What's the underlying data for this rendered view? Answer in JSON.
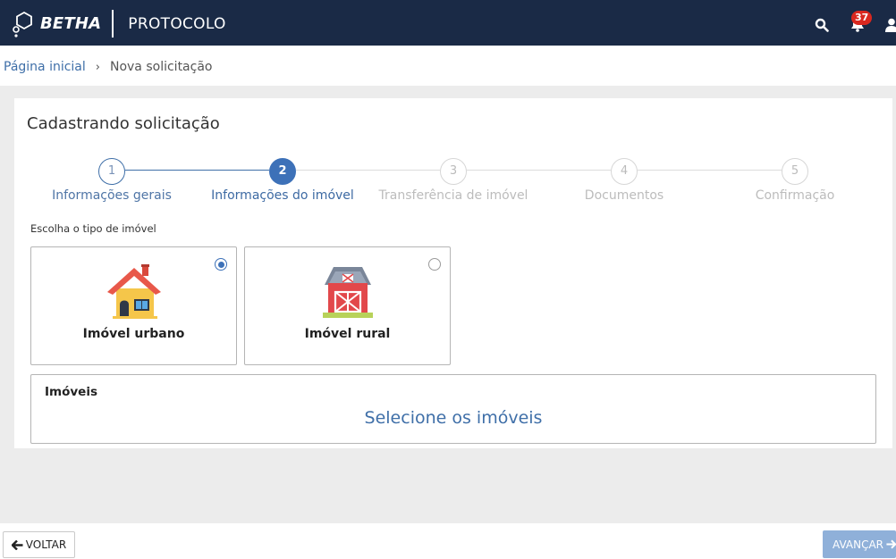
{
  "header": {
    "brand_name": "BETHA",
    "app_name": "PROTOCOLO",
    "notification_count": "37",
    "icons": [
      "betha-logo-icon",
      "search-icon",
      "bell-icon",
      "user-icon"
    ]
  },
  "breadcrumb": {
    "home": "Página inicial",
    "separator": "›",
    "current": "Nova solicitação"
  },
  "card": {
    "title": "Cadastrando solicitação"
  },
  "stepper": {
    "current_step": 2,
    "steps": [
      {
        "number": "1",
        "label": "Informações gerais",
        "state": "done"
      },
      {
        "number": "2",
        "label": "Informações do imóvel",
        "state": "active"
      },
      {
        "number": "3",
        "label": "Transferência de imóvel",
        "state": "pending"
      },
      {
        "number": "4",
        "label": "Documentos",
        "state": "pending"
      },
      {
        "number": "5",
        "label": "Confirmação",
        "state": "pending"
      }
    ]
  },
  "property_type": {
    "label": "Escolha o tipo de imóvel",
    "selected": "urbano",
    "options": [
      {
        "id": "urbano",
        "label": "Imóvel urbano",
        "icon": "house-icon",
        "checked": true
      },
      {
        "id": "rural",
        "label": "Imóvel rural",
        "icon": "barn-icon",
        "checked": false
      }
    ]
  },
  "imoveis": {
    "title": "Imóveis",
    "action": "Selecione os imóveis"
  },
  "footer": {
    "back_label": "VOLTAR",
    "next_label": "AVANÇAR"
  },
  "colors": {
    "topbar": "#1a2a46",
    "accent": "#3d71b8",
    "link": "#3f6fa8",
    "next_button": "#8fb0d9",
    "badge": "#d9281f"
  }
}
